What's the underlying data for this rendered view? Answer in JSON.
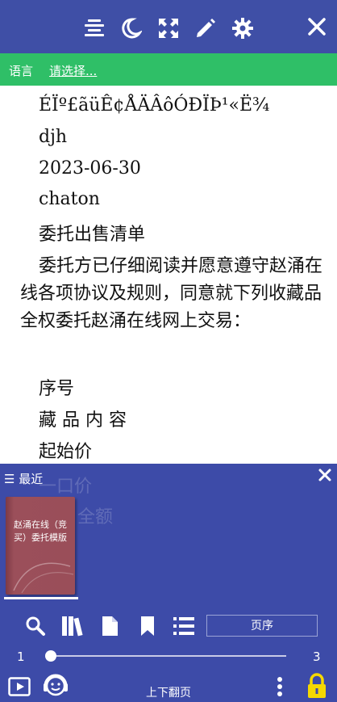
{
  "toolbar": {
    "icons": [
      "align-icon",
      "moon-icon",
      "fullscreen-icon",
      "pencil-icon",
      "gear-icon",
      "close-icon"
    ]
  },
  "language_bar": {
    "label": "语言",
    "select_text": "请选择..."
  },
  "document": {
    "lines": [
      "ÉÏº£ãüÊ¢ÅÄÂôÓÐÏÞ¹«Ë¾",
      "djh",
      "2023-06-30",
      "chaton",
      "委托出售清单"
    ],
    "paragraph": "委托方已仔细阅读并愿意遵守赵涌在线各项协议及规则，同意就下列收藏品全权委托赵涌在线网上交易：",
    "lines2": [
      "序号",
      "藏 品 内 容",
      "起始价"
    ],
    "ghost_lines": [
      "一口价",
      "全额"
    ]
  },
  "panel": {
    "recent_label": "☰ 最近",
    "book_title": "赵涌在线（竞买）委托模版",
    "order_button": "页序",
    "page_start": "1",
    "page_end": "3",
    "progress_fraction": 0.0,
    "bottom_label": "上下翻页",
    "accent_lock_color": "#f5d800"
  }
}
